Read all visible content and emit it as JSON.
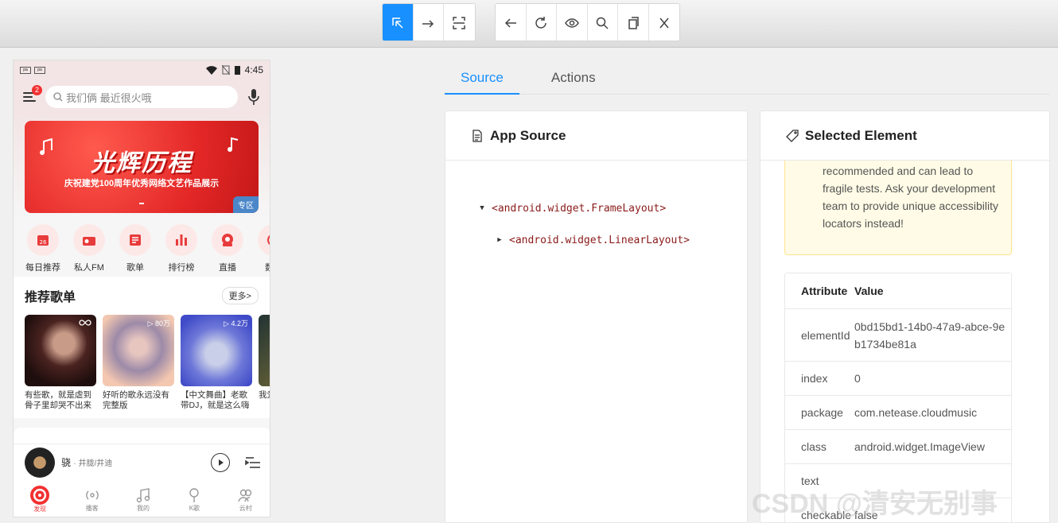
{
  "toolbar": {
    "tools": [
      {
        "icon": "select-element-icon",
        "active": true
      },
      {
        "icon": "swipe-arrow-icon",
        "active": false
      },
      {
        "icon": "tap-coordinates-icon",
        "active": false
      }
    ],
    "actions": [
      {
        "icon": "back-arrow-icon"
      },
      {
        "icon": "refresh-icon"
      },
      {
        "icon": "eye-icon"
      },
      {
        "icon": "search-icon"
      },
      {
        "icon": "copy-icon"
      },
      {
        "icon": "close-icon"
      }
    ]
  },
  "phone": {
    "status": {
      "time": "4:45",
      "tags": [
        "pa",
        "pa"
      ]
    },
    "menu_badge": "2",
    "search_placeholder": "我们俩 最近很火哦",
    "banner": {
      "title": "光辉历程",
      "subtitle": "庆祝建党100周年优秀网络文艺作品展示",
      "tag": "专区"
    },
    "nav": [
      {
        "label": "每日推荐",
        "icon": "calendar-icon"
      },
      {
        "label": "私人FM",
        "icon": "radio-icon"
      },
      {
        "label": "歌单",
        "icon": "playlist-icon"
      },
      {
        "label": "排行榜",
        "icon": "chart-icon"
      },
      {
        "label": "直播",
        "icon": "live-icon"
      },
      {
        "label": "数字",
        "icon": "album-icon"
      }
    ],
    "recommend": {
      "title": "推荐歌单",
      "more": "更多>",
      "playlists": [
        {
          "count": "",
          "text": "有些歌，就是虐到骨子里却哭不出来"
        },
        {
          "count": "▷ 80万",
          "text": "好听的歌永远没有完整版"
        },
        {
          "count": "▷ 4.2万",
          "text": "【中文舞曲】老歌带DJ，就是这么嗨"
        },
        {
          "count": "",
          "text": "我爱所有"
        }
      ]
    },
    "player": {
      "song": "骁",
      "artist": "井胧/井迪"
    },
    "tabs": [
      {
        "label": "发现",
        "icon": "discover-icon",
        "active": true
      },
      {
        "label": "播客",
        "icon": "podcast-icon",
        "active": false
      },
      {
        "label": "我的",
        "icon": "music-note-icon",
        "active": false
      },
      {
        "label": "K歌",
        "icon": "microphone-icon",
        "active": false
      },
      {
        "label": "云村",
        "icon": "users-icon",
        "active": false
      }
    ]
  },
  "tabs": [
    {
      "label": "Source",
      "active": true
    },
    {
      "label": "Actions",
      "active": false
    }
  ],
  "source_panel": {
    "title": "App Source",
    "tree": [
      {
        "label": "<android.widget.FrameLayout>",
        "expanded": true,
        "depth": 0
      },
      {
        "label": "<android.widget.LinearLayout>",
        "expanded": false,
        "depth": 1
      }
    ]
  },
  "selected_panel": {
    "title": "Selected Element",
    "warning": "recommended and can lead to fragile tests. Ask your development team to provide unique accessibility locators instead!",
    "headers": {
      "attribute": "Attribute",
      "value": "Value"
    },
    "attributes": [
      {
        "k": "elementId",
        "v": "0bd15bd1-14b0-47a9-abce-9eb1734be81a"
      },
      {
        "k": "index",
        "v": "0"
      },
      {
        "k": "package",
        "v": "com.netease.cloudmusic"
      },
      {
        "k": "class",
        "v": "android.widget.ImageView"
      },
      {
        "k": "text",
        "v": ""
      },
      {
        "k": "checkable",
        "v": "false"
      }
    ]
  },
  "watermark": "CSDN @清安无别事"
}
